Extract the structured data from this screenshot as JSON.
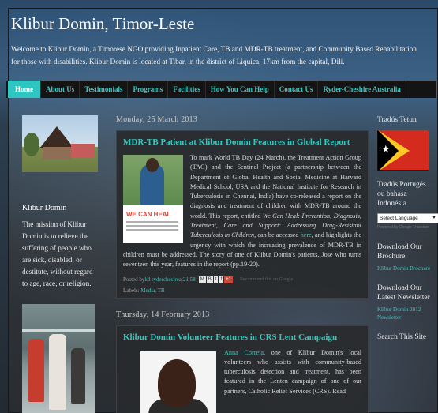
{
  "site": {
    "title": "Klibur Domin, Timor-Leste",
    "description": "Welcome to Klibur Domin, a Timorese NGO providing Inpatient Care, TB and MDR-TB treatment, and Community Based Rehabilitation for those with disabilities. Klibur Domin is located at Tibar, in the district of Liquica, 17km from the capital, Dili."
  },
  "nav": {
    "items": [
      "Home",
      "About Us",
      "Testimonials",
      "Programs",
      "Facilities",
      "How You Can Help",
      "Contact Us",
      "Ryder-Cheshire Australia"
    ]
  },
  "sidebar_left": {
    "title": "Klibur Domin",
    "text": "The mission of Klibur Domin is to relieve the suffering of people who are sick, disabled, or destitute, without regard to age, race, or religion."
  },
  "posts": [
    {
      "date": "Monday, 25 March 2013",
      "title": "MDR-TB Patient at Klibur Domin Features in Global Report",
      "image_caption": "WE CAN HEAL",
      "body_1": "To mark World TB Day (24 March), the Treatment Action Group (TAG) and the Sentinel Project (a partnership between the Department of Global Health and Social Medicine at Harvard Medical School, USA and the National Institute for Research in Tuberculosis in Chennai, India) have co-released a report on the diagnosis and treatment of children with MDR-TB around the world. This report, entitled ",
      "body_em": "We Can Heal: Prevention, Diagnosis, Treatment, Care and Support: Addressing Drug-Resistant Tuberculosis in Children",
      "body_2": ", can be accessed ",
      "body_link": "here",
      "body_3": ", and highlights the urgency with which the increasing prevalence of MDR-TB in children must be addressed. The story of one of Klibur Domin's patients, Jose who turns seventeen this year, features in the report (pp.19-20).",
      "posted_by_prefix": "Posted by ",
      "author": "kd ryderchesire",
      "at": " at ",
      "time": "21:58",
      "share_buttons": [
        "M",
        "B",
        "t",
        "f",
        "+1"
      ],
      "recommend": "Recommend this on Google",
      "labels_prefix": "Labels: ",
      "labels": "Media, TB"
    },
    {
      "date": "Thursday, 14 February 2013",
      "title": "Klibur Domin Volunteer Features in CRS Lent Campaign",
      "name_link": "Anna Correia",
      "body": ", one of Klibur Domin's local volunteers who assists with community-based tuberculosis detection and treatment, has been featured in the Lenten campaign of one of our partners, Catholic Relief Services (CRS). Read"
    }
  ],
  "sidebar_right": {
    "translate_title": "Tradús Tetun",
    "translate_title_2": "Tradús Portugés ou bahasa Indonésia",
    "select_value": "Select Language",
    "powered_by": "Powered by Google Translate",
    "brochure_title": "Download Our Brochure",
    "brochure_link": "Klibur Domin Brochure",
    "newsletter_title": "Download Our Latest Newsletter",
    "newsletter_link": "Klibur Domin 2012 Newsletter",
    "search_title": "Search This Site"
  },
  "colors": {
    "accent": "#34c7be",
    "nav_bg": "#141414",
    "active_tab": "#2ec6c0"
  }
}
